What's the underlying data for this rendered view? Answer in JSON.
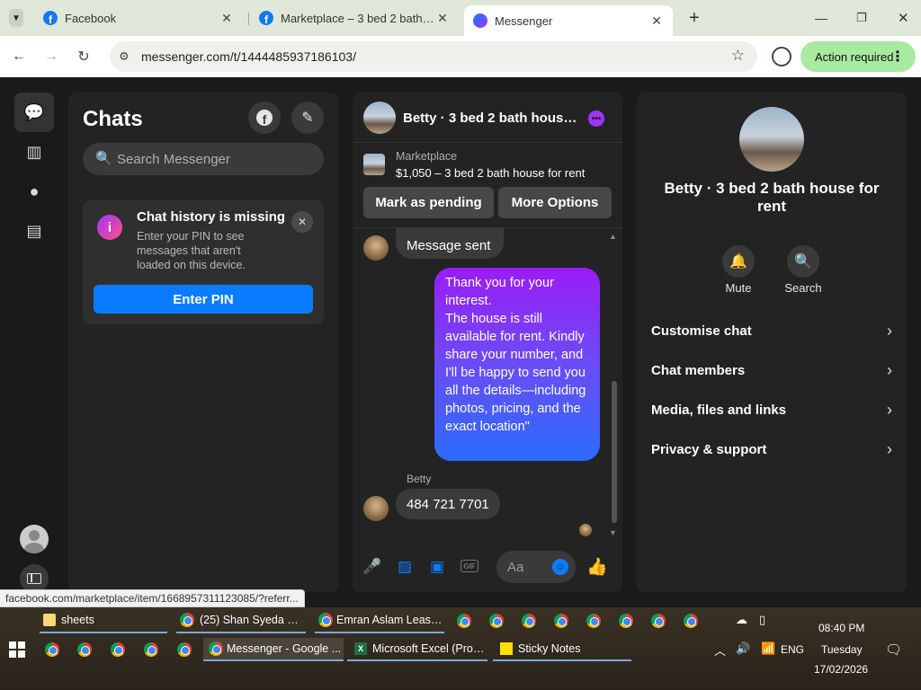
{
  "browser": {
    "tabs": [
      {
        "title": "Facebook",
        "icon": "facebook-icon"
      },
      {
        "title": "Marketplace – 3 bed 2 bath house for rent",
        "icon": "facebook-icon"
      },
      {
        "title": "Messenger",
        "icon": "messenger-icon"
      }
    ],
    "url": "messenger.com/t/1444485937186103/",
    "action_required": "Action required",
    "status_url": "facebook.com/marketplace/item/1668957311123085/?referr..."
  },
  "chats": {
    "title": "Chats",
    "search_placeholder": "Search Messenger",
    "history_card": {
      "title": "Chat history is missing",
      "body": "Enter your PIN to see messages that aren't loaded on this device.",
      "button": "Enter PIN"
    }
  },
  "conversation": {
    "name": "Betty · 3 bed 2 bath house for rent",
    "marketplace_label": "Marketplace",
    "listing": "$1,050 – 3 bed 2 bath house for rent",
    "mark_pending": "Mark as pending",
    "more_options": "More Options",
    "messages": {
      "received_1": "Message sent",
      "sent_lines": [
        "Thank you for your interest.",
        "The house is still available for rent. Kindly share your number, and I'll be happy to send you all the details—including photos, pricing, and the exact location\""
      ],
      "sender_label": "Betty",
      "received_2": "484 721 7701"
    },
    "input_placeholder": "Aa"
  },
  "info": {
    "name": "Betty · 3 bed 2 bath house for rent",
    "actions": [
      {
        "label": "Mute",
        "icon": "bell-icon"
      },
      {
        "label": "Search",
        "icon": "search-icon"
      }
    ],
    "rows": [
      "Customise chat",
      "Chat members",
      "Media, files and links",
      "Privacy & support"
    ]
  },
  "taskbar": {
    "top_items": [
      {
        "label": "sheets"
      },
      {
        "label": "(25) Shan Syeda Fati..."
      },
      {
        "label": "Emran Aslam Leas T..."
      }
    ],
    "bottom_items": [
      {
        "label": "Messenger - Google ..."
      },
      {
        "label": "Microsoft Excel (Prod..."
      },
      {
        "label": "Sticky Notes"
      }
    ],
    "language": "ENG",
    "time": "08:40 PM",
    "day": "Tuesday",
    "date": "17/02/2026"
  },
  "colors": {
    "accent_blue": "#0a7cff",
    "accent_purple": "#a033ff",
    "action_green": "#a7eaa0"
  }
}
